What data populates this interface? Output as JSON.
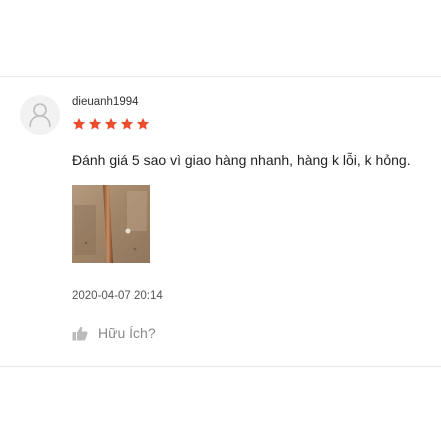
{
  "review": {
    "username": "dieuanh1994",
    "rating": 5,
    "max_rating": 5,
    "comment": "Đánh giá 5 sao vì giao hàng nhanh, hàng k lỗi, k hỏng.",
    "timestamp": "2020-04-07 20:14",
    "helpful_label": "Hữu Ích?",
    "photo_count": 1
  },
  "icons": {
    "avatar": "user-placeholder-icon",
    "star": "star-icon",
    "helpful": "thumbs-up-icon"
  },
  "colors": {
    "star": "#ee4d2d",
    "muted_icon": "#bbbbbb",
    "divider": "#e8e8e8"
  }
}
